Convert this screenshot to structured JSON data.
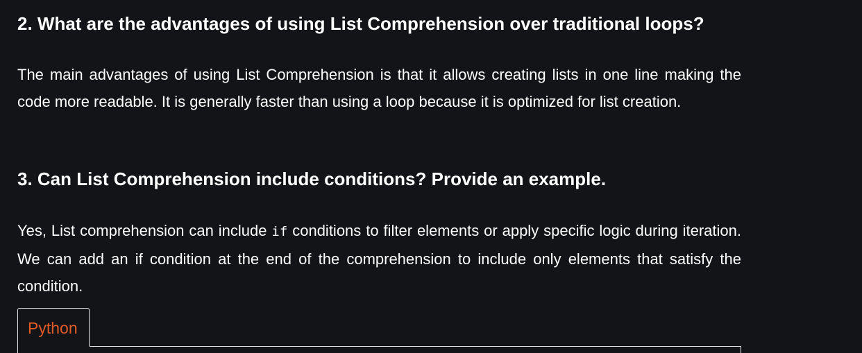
{
  "sections": [
    {
      "heading": "2. What are the advantages of using List Comprehension over traditional loops?",
      "answer": "The main advantages of using List Comprehension is that it allows creating lists in one line making the code more readable. It is generally faster than using a loop because it is optimized for list creation."
    },
    {
      "heading": "3. Can List Comprehension include conditions? Provide an example.",
      "answer_before_code": "Yes, List comprehension can include ",
      "answer_code": "if",
      "answer_after_code": " conditions to filter elements or apply specific logic during iteration. We can add an if condition at the end of the comprehension to include only elements that satisfy the condition."
    }
  ],
  "code_block": {
    "tab_label": "Python",
    "accent_color": "#e05a26"
  },
  "colors": {
    "background": "#131417",
    "text": "#ffffff",
    "border": "#e8e8e8"
  }
}
